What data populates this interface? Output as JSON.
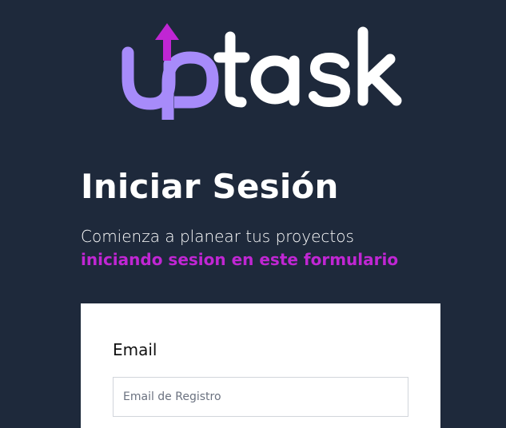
{
  "logo": {
    "name": "uptask",
    "icon": "arrow-up-icon",
    "colors": {
      "up": "#a78bfa",
      "arrow": "#c026d3",
      "task": "#ffffff"
    }
  },
  "heading": "Iniciar Sesión",
  "subtitle": {
    "line1": "Comienza a planear tus proyectos",
    "line2": "iniciando sesion en este formulario"
  },
  "form": {
    "email_label": "Email",
    "email_placeholder": "Email de Registro",
    "email_value": ""
  },
  "colors": {
    "background": "#1e293b",
    "accent": "#c026d3",
    "card": "#ffffff"
  }
}
